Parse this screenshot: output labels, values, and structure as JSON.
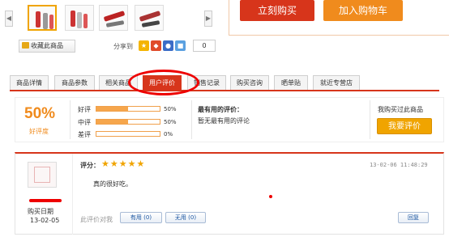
{
  "buttons": {
    "buy_now": "立刻购买",
    "add_cart": "加入购物车",
    "favorite": "收藏此商品"
  },
  "share": {
    "label": "分享到",
    "count": "0",
    "icons": [
      "star-icon",
      "group-icon",
      "paw-icon",
      "blue-share-icon"
    ]
  },
  "tabs": [
    {
      "label": "商品详情",
      "active": false
    },
    {
      "label": "商品参数",
      "active": false
    },
    {
      "label": "相关商品",
      "active": false
    },
    {
      "label": "用户评价",
      "active": true
    },
    {
      "label": "销售记录",
      "active": false
    },
    {
      "label": "购买咨询",
      "active": false
    },
    {
      "label": "晒单贴",
      "active": false
    },
    {
      "label": "就近专营店",
      "active": false
    }
  ],
  "summary": {
    "percent": "50%",
    "percent_label": "好评度",
    "ratings": [
      {
        "label": "好评",
        "percent": "50%",
        "fill": 0.5
      },
      {
        "label": "中评",
        "percent": "50%",
        "fill": 0.5
      },
      {
        "label": "差评",
        "percent": "0%",
        "fill": 0
      }
    ],
    "useful_title": "最有用的评价：",
    "useful_text": "暂无最有用的评论",
    "bought_label": "我购买过此商品",
    "review_button": "我要评价"
  },
  "comment": {
    "score_label": "评分：",
    "stars": "★★★★★",
    "time": "13-02-06 11:48:29",
    "text": "真的很好吃。",
    "buy_date_label": "购买日期",
    "buy_date": "13-02-05",
    "helpful_question": "此评价对我",
    "useful_btn": "有用 (0)",
    "useless_btn": "无用 (0)",
    "reply_btn": "回复"
  },
  "colors": {
    "brand_red": "#d7351b",
    "orange": "#f08b1d",
    "gold": "#f0a400"
  }
}
